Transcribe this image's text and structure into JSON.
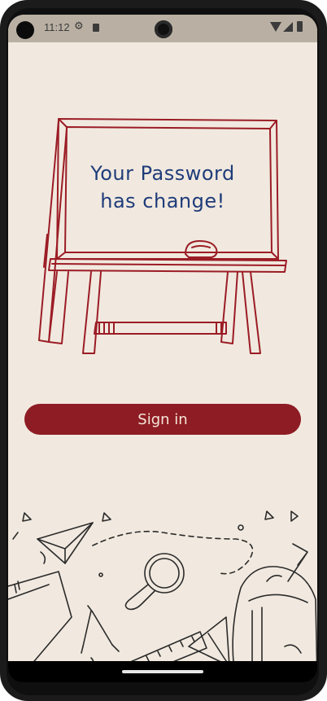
{
  "status_bar": {
    "time": "11:12",
    "icons": [
      "settings-gear-icon",
      "sd-card-icon",
      "wifi-icon",
      "cell-signal-icon",
      "battery-icon"
    ]
  },
  "hero": {
    "message_line1": "Your Password",
    "message_line2": "has change!"
  },
  "actions": {
    "sign_in_label": "Sign in"
  },
  "colors": {
    "background": "#f1e9df",
    "accent": "#8e1c24",
    "board_text": "#1f3c7a",
    "illustration": "#9b1c25"
  }
}
